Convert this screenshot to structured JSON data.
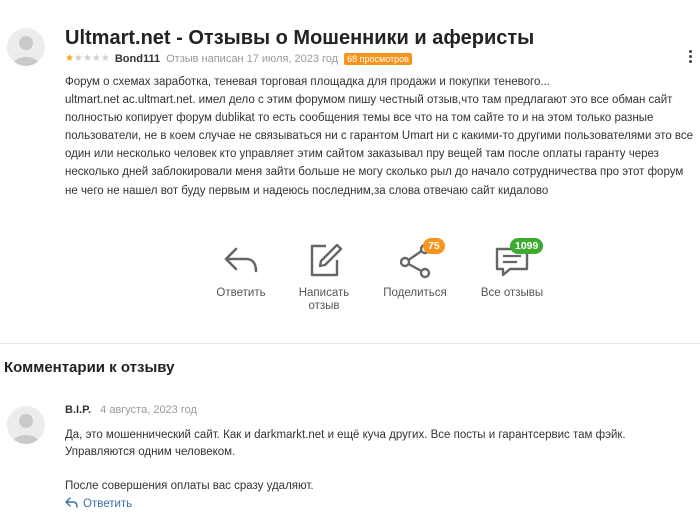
{
  "review": {
    "title": "Ultmart.net - Отзывы о Мошенники и аферисты",
    "rating": 1,
    "rating_max": 5,
    "author": "Bond111",
    "date": "Отзыв написан 17 июля, 2023 год",
    "views": "68 просмотров",
    "summary": "Форум о схемах заработка, теневая торговая площадка для продажи и покупки теневого...",
    "text": "ultmart.net ac.ultmart.net. имел дело с этим форумом пишу честный отзыв,что там предлагают это все обман сайт полностью копирует форум dublikat то есть сообщения темы все что на том сайте то и на этом только разные пользователи, не в коем случае не связываться ни с гарантом Umart ни с какими-то другими пользователями это все один или несколько человек кто управляет этим сайтом заказывал пру вещей там после оплаты гаранту через несколько дней заблокировали меня зайти больше не могу сколько рыл до начало сотрудничества про этот форум не чего не нашел вот буду первым и надеюсь последним,за слова отвечаю сайт кидалово"
  },
  "actions": {
    "reply": "Ответить",
    "write_review_line1": "Написать",
    "write_review_line2": "отзыв",
    "share": "Поделиться",
    "share_count": "75",
    "all_reviews": "Все отзывы",
    "all_reviews_count": "1099"
  },
  "comments": {
    "title": "Комментарии к отзыву",
    "items": [
      {
        "author": "B.I.P.",
        "date": "4 августа, 2023 год",
        "paragraph1": "Да, это мошеннический сайт. Как и darkmarkt.net и ещё куча других. Все посты и гарантсервис там фэйк. Управляются одним человеком.",
        "paragraph2": "После совершения оплаты вас сразу удаляют.",
        "reply_label": "Ответить"
      }
    ]
  },
  "colors": {
    "star_on": "#f7a21b",
    "views_badge": "#f7941d",
    "share_badge": "#f7941d",
    "all_reviews_badge": "#3cac30",
    "link": "#3a6ea5"
  },
  "icons": [
    "avatar-icon",
    "kebab-menu-icon",
    "reply-icon",
    "edit-icon",
    "share-icon",
    "comments-icon"
  ]
}
